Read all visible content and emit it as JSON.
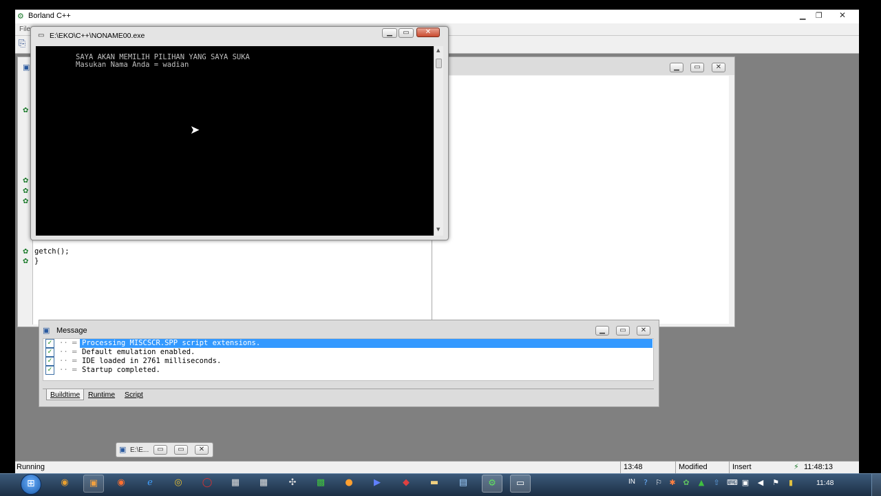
{
  "ide": {
    "title": "Borland C++",
    "menu_stub": "File",
    "status_running": "Running",
    "status_position": "13:48",
    "status_modified": "Modified",
    "status_insert": "Insert",
    "status_time": "11:48:13"
  },
  "console": {
    "title": "E:\\EKO\\C++\\NONAME00.exe",
    "line1": "SAYA AKAN MEMILIH PILIHAN YANG SAYA SUKA",
    "line2": "Masukan Nama Anda = wadian"
  },
  "editor": {
    "code_line1": "getch();",
    "code_line2": "}"
  },
  "message": {
    "title": "Message",
    "rows": [
      "Processing MISCSCR.SPP script extensions.",
      "Default emulation enabled.",
      "IDE loaded in 2761 milliseconds.",
      "Startup completed."
    ],
    "tabs": [
      "Buildtime",
      "Runtime",
      "Script"
    ]
  },
  "minimized": {
    "label": "E:\\E..."
  },
  "taskbar": {
    "lang": "IN",
    "clock": "11:48",
    "icons": [
      "start-orb-icon",
      "firefox-icon",
      "explorer-icon",
      "firefox-alt-icon",
      "ie-icon",
      "chrome-icon",
      "opera-icon",
      "calc-icon",
      "calc2-icon",
      "tool-icon",
      "excel-icon",
      "media-icon",
      "app-icon",
      "app2-icon",
      "folder-icon",
      "notepad-icon",
      "borland-icon",
      "window-icon"
    ]
  },
  "colors": {
    "selection": "#3399ff",
    "desktop": "#808080",
    "console_bg": "#000000",
    "console_fg": "#c0c0c0"
  }
}
